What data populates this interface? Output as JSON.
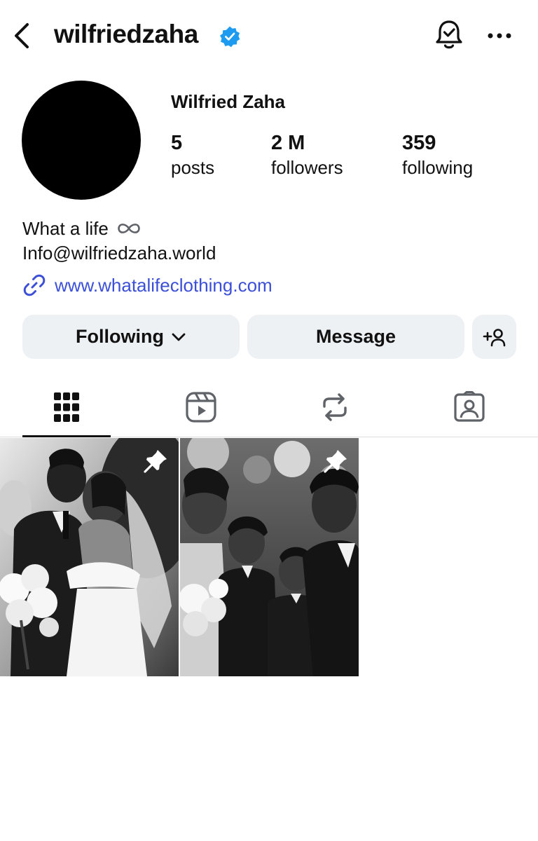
{
  "header": {
    "username": "wilfriedzaha",
    "back_icon": "chevron-left-icon",
    "verified_icon": "verified-badge-icon",
    "notification_icon": "bell-check-icon",
    "more_icon": "more-horizontal-icon"
  },
  "profile": {
    "full_name": "Wilfried Zaha",
    "stats": {
      "posts_count": "5",
      "posts_label": "posts",
      "followers_count": "2 M",
      "followers_label": "followers",
      "following_count": "359",
      "following_label": "following"
    },
    "bio": {
      "line1": "What a life",
      "line1_icon": "infinity-icon",
      "line2": "Info@wilfriedzaha.world",
      "link_icon": "link-icon",
      "link": "www.whatalifeclothing.com"
    }
  },
  "actions": {
    "following_label": "Following",
    "message_label": "Message",
    "add_user_icon": "add-user-icon"
  },
  "tabs": [
    {
      "name": "grid",
      "icon": "grid-icon",
      "active": true
    },
    {
      "name": "reels",
      "icon": "reels-icon",
      "active": false
    },
    {
      "name": "reposts",
      "icon": "repost-icon",
      "active": false
    },
    {
      "name": "tagged",
      "icon": "tagged-icon",
      "active": false
    }
  ],
  "posts": [
    {
      "pinned": true,
      "pin_icon": "pin-icon",
      "scene": "bride-and-groom-bw-photo"
    },
    {
      "pinned": true,
      "pin_icon": "pin-icon",
      "scene": "wedding-family-bw-photo"
    }
  ],
  "colors": {
    "link": "#3b4fd8",
    "verified": "#1d9bf0",
    "button_bg": "#eef1f4",
    "icon_gray": "#5f6368"
  }
}
